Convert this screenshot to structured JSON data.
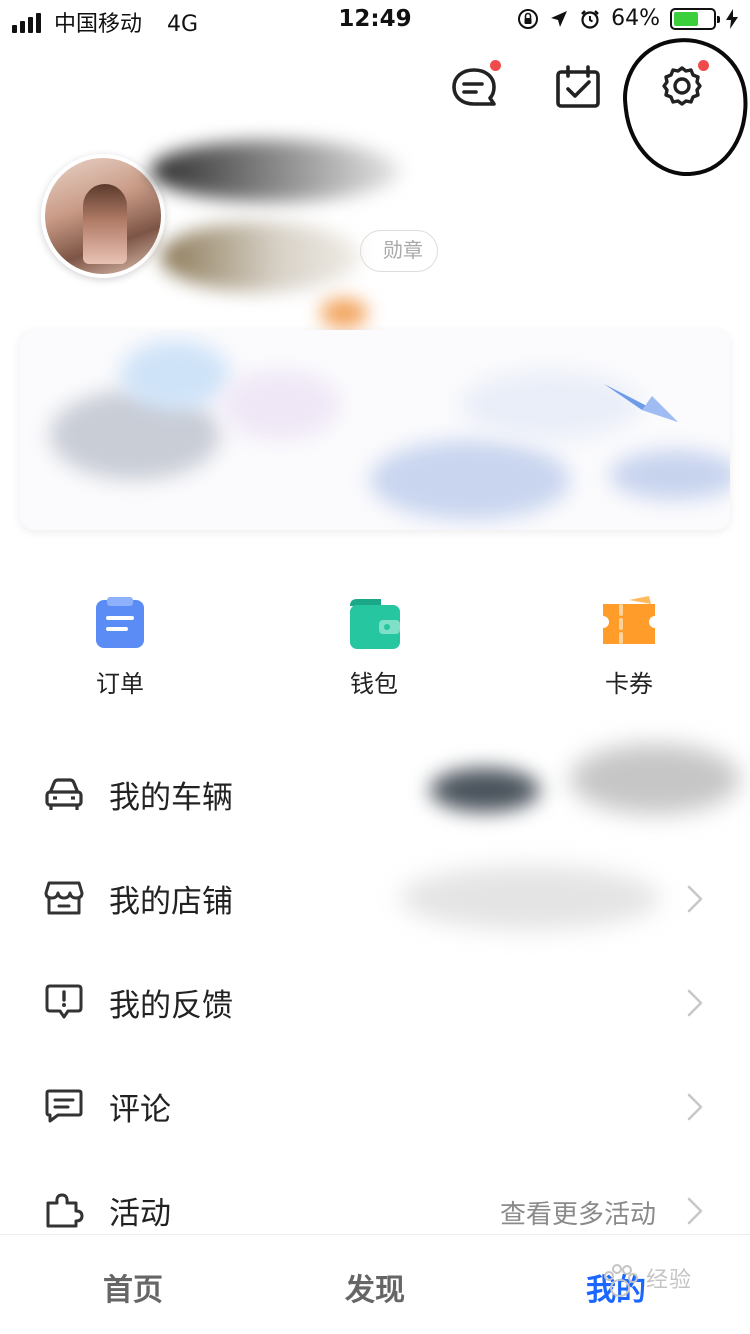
{
  "status_bar": {
    "carrier": "中国移动",
    "network": "4G",
    "time": "12:49",
    "battery_percent": "64%",
    "battery_level": 0.64,
    "battery_color": "#3ccf3c"
  },
  "header": {
    "icons": [
      "message-icon",
      "checkin-calendar-icon",
      "settings-icon"
    ],
    "notification_dot_color": "#f24b4b"
  },
  "profile": {
    "badge_text": "勋章"
  },
  "quick_actions": [
    {
      "label": "订单",
      "icon": "order-icon",
      "color": "#5b8cf5"
    },
    {
      "label": "钱包",
      "icon": "wallet-icon",
      "color": "#25c6a0"
    },
    {
      "label": "卡券",
      "icon": "coupon-icon",
      "color": "#ff9c2a"
    }
  ],
  "menu": [
    {
      "label": "我的车辆",
      "icon": "car-icon",
      "extra": ""
    },
    {
      "label": "我的店铺",
      "icon": "store-icon",
      "extra": ""
    },
    {
      "label": "我的反馈",
      "icon": "feedback-icon",
      "extra": ""
    },
    {
      "label": "评论",
      "icon": "comment-icon",
      "extra": ""
    },
    {
      "label": "活动",
      "icon": "puzzle-icon",
      "extra": "查看更多活动"
    }
  ],
  "tabbar": {
    "tabs": [
      {
        "label": "首页",
        "active": false
      },
      {
        "label": "发现",
        "active": false
      },
      {
        "label": "我的",
        "active": true
      }
    ],
    "active_color": "#1a66ff",
    "watermark_text": "经验"
  }
}
